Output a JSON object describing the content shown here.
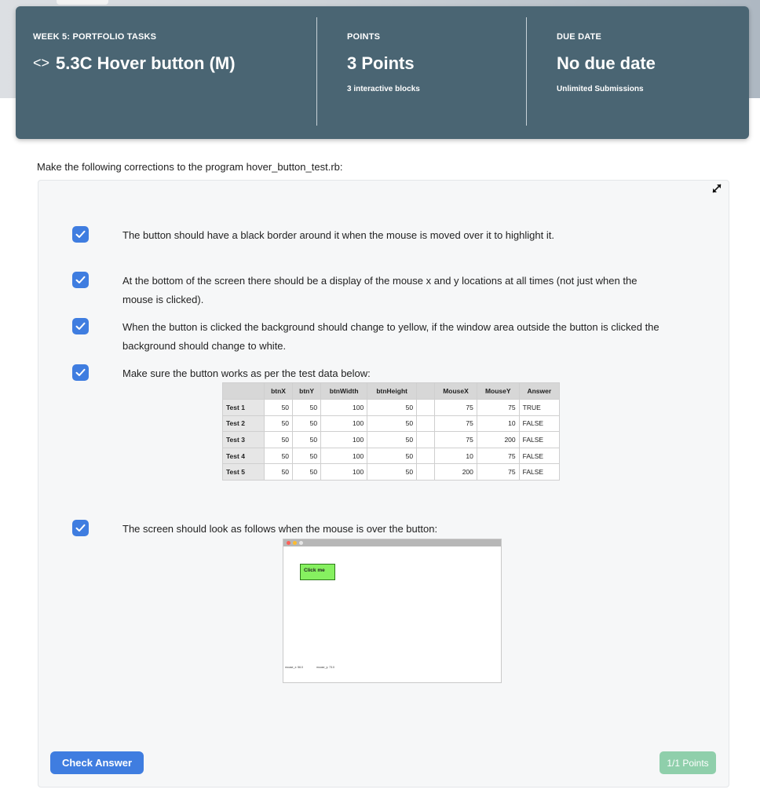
{
  "banner": {
    "week_label": "WEEK 5: PORTFOLIO TASKS",
    "task_icon": "code-icon",
    "task_title": "5.3C Hover button (M)",
    "points_label": "POINTS",
    "points_value": "3 Points",
    "points_sub": "3 interactive blocks",
    "due_label": "DUE DATE",
    "due_value": "No due date",
    "due_sub": "Unlimited Submissions"
  },
  "intro": "Make the following corrections to the program hover_button_test.rb:",
  "items": [
    {
      "text": "The button should have a black border around it when the mouse is moved over it to highlight it.",
      "checked": true
    },
    {
      "text": "At the bottom of the screen there should be a display of the mouse x and y locations at all times (not just when the mouse is clicked).",
      "checked": true
    },
    {
      "text": "When the button is clicked the background should change to yellow, if the window area outside the button is clicked the background should change to white.",
      "checked": true
    },
    {
      "text": "Make sure the button works as per the test data below:",
      "checked": true
    },
    {
      "text": "The screen should look as follows when the mouse is over the button:",
      "checked": true
    }
  ],
  "table": {
    "headers": [
      "",
      "btnX",
      "btnY",
      "btnWidth",
      "btnHeight",
      "",
      "MouseX",
      "MouseY",
      "Answer"
    ],
    "rows": [
      [
        "Test 1",
        "50",
        "50",
        "100",
        "50",
        "",
        "75",
        "75",
        "TRUE"
      ],
      [
        "Test 2",
        "50",
        "50",
        "100",
        "50",
        "",
        "75",
        "10",
        "FALSE"
      ],
      [
        "Test 3",
        "50",
        "50",
        "100",
        "50",
        "",
        "75",
        "200",
        "FALSE"
      ],
      [
        "Test 4",
        "50",
        "50",
        "100",
        "50",
        "",
        "10",
        "75",
        "FALSE"
      ],
      [
        "Test 5",
        "50",
        "50",
        "100",
        "50",
        "",
        "200",
        "75",
        "FALSE"
      ]
    ]
  },
  "preview": {
    "button_label": "Click me",
    "mouse_x": "mouse_x: 56.0",
    "mouse_y": "mouse_y: 73.0",
    "button_color": "#86f060"
  },
  "footer": {
    "check_label": "Check Answer",
    "score": "1/1 Points"
  },
  "colors": {
    "banner": "#4a6573",
    "accent": "#3f7de0",
    "score_badge": "#8fcfab"
  }
}
